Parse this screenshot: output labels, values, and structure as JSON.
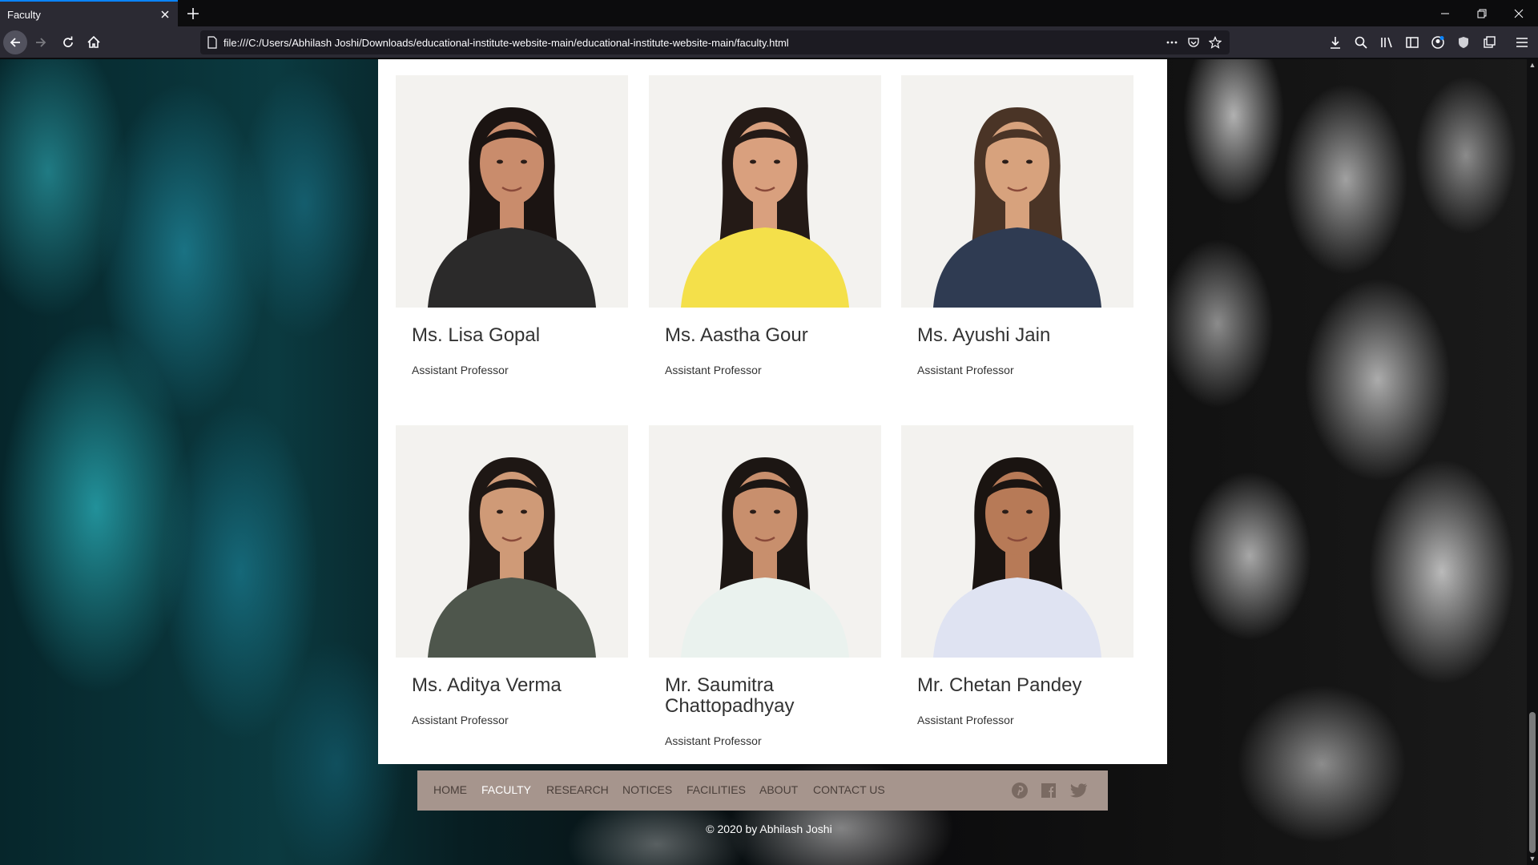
{
  "browser": {
    "tab_title": "Faculty",
    "url": "file:///C:/Users/Abhilash Joshi/Downloads/educational-institute-website-main/educational-institute-website-main/faculty.html"
  },
  "faculty": [
    {
      "name": "Ms. Lisa Gopal",
      "role": "Assistant Professor",
      "shirt": "#2b2a2a",
      "skin": "#c98c6c",
      "hair": "#1b1412"
    },
    {
      "name": "Ms. Aastha Gour",
      "role": "Assistant Professor",
      "shirt": "#f4e04a",
      "skin": "#d9a07e",
      "hair": "#241a16"
    },
    {
      "name": "Ms. Ayushi Jain",
      "role": "Assistant Professor",
      "shirt": "#2f3b52",
      "skin": "#d7a27d",
      "hair": "#4a3426"
    },
    {
      "name": "Ms. Aditya Verma",
      "role": "Assistant Professor",
      "shirt": "#4e564c",
      "skin": "#cf9a77",
      "hair": "#1e1714"
    },
    {
      "name": "Mr. Saumitra Chattopadhyay",
      "role": "Assistant Professor",
      "shirt": "#eaf2ee",
      "skin": "#c88f6d",
      "hair": "#1c1613"
    },
    {
      "name": "Mr. Chetan Pandey",
      "role": "Assistant Professor",
      "shirt": "#dfe3f2",
      "skin": "#b77a57",
      "hair": "#1a1411"
    }
  ],
  "footer": {
    "nav": [
      "HOME",
      "FACULTY",
      "RESEARCH",
      "NOTICES",
      "FACILITIES",
      "ABOUT",
      "CONTACT US"
    ],
    "active": "FACULTY",
    "social_icons": [
      "pinterest-icon",
      "facebook-icon",
      "twitter-icon"
    ],
    "copyright": "© 2020 by Abhilash Joshi"
  }
}
